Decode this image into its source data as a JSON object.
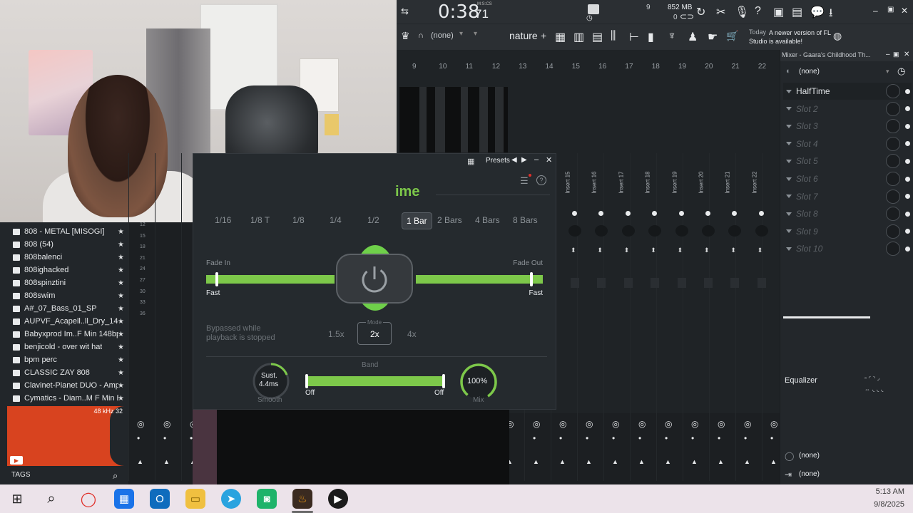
{
  "transport": {
    "time_main": "0:38",
    "time_frac": "71",
    "time_unit": "M:S:CS",
    "cpu_label": "9",
    "memory": "852 MB",
    "memory_sub": "0"
  },
  "toolbar": {
    "preset_none": "(none)",
    "pattern_name": "nature",
    "add_label": "+"
  },
  "notice": {
    "when": "Today",
    "text": "A newer version of FL Studio is available!"
  },
  "playlist": {
    "ruler": [
      "9",
      "10",
      "11",
      "12",
      "13",
      "14",
      "15",
      "16",
      "17",
      "18",
      "19",
      "20",
      "21",
      "22"
    ]
  },
  "mixer_window": {
    "title": "Mixer - Gaara's Childhood Th...",
    "preset": "(none)",
    "slots": [
      {
        "label": "HalfTime",
        "active": true
      },
      {
        "label": "Slot 2"
      },
      {
        "label": "Slot 3"
      },
      {
        "label": "Slot 4"
      },
      {
        "label": "Slot 5"
      },
      {
        "label": "Slot 6"
      },
      {
        "label": "Slot 7"
      },
      {
        "label": "Slot 8"
      },
      {
        "label": "Slot 9"
      },
      {
        "label": "Slot 10"
      }
    ],
    "equalizer_label": "Equalizer",
    "route1": "(none)",
    "route2": "(none)"
  },
  "inserts": [
    "Insert 15",
    "Insert 16",
    "Insert 17",
    "Insert 18",
    "Insert 19",
    "Insert 20",
    "Insert 21",
    "Insert 22"
  ],
  "browser": {
    "items": [
      "808 - METAL [MISOGI]",
      "808 (54)",
      "808balenci",
      "808ighacked",
      "808spinztini",
      "808swim",
      "A#_07_Bass_01_SP",
      "AUPVF_Acapell..ll_Dry_140_Bm",
      "Babyxprod Im..F Min 148bpm]",
      "benjicold - over wit hat",
      "bpm perc",
      "CLASSIC ZAY 808",
      "Clavinet-Pianet DUO - Amp",
      "Cymatics - Diam..M F Min Bass"
    ],
    "sample_rate": "48 kHz 32",
    "tags_label": "TAGS"
  },
  "row_numbers": [
    "12",
    "15",
    "18",
    "21",
    "24",
    "27",
    "30",
    "33",
    "36"
  ],
  "plugin": {
    "presets_label": "Presets",
    "title_fragment": "ime",
    "tabs": [
      "1/16",
      "1/8 T",
      "1/8",
      "1/4",
      "1/2",
      "1 Bar",
      "2 Bars",
      "4 Bars",
      "8 Bars"
    ],
    "active_tab": "1 Bar",
    "fade_in_label": "Fade In",
    "fade_out_label": "Fade Out",
    "fade_in_value": "Fast",
    "fade_out_value": "Fast",
    "bypass_text_1": "Bypassed while",
    "bypass_text_2": "playback is stopped",
    "mode_label": "Mode",
    "modes": [
      "1.5x",
      "2x",
      "4x"
    ],
    "active_mode": "2x",
    "band_label": "Band",
    "band_low": "Off",
    "band_high": "Off",
    "sustain_label": "Sust.",
    "sustain_value": "4.4ms",
    "smooth_label": "Smooth",
    "mix_value": "100%",
    "mix_label": "Mix"
  },
  "taskbar": {
    "time": "5:13 AM",
    "date": "9/8/2025"
  },
  "colors": {
    "accent_green": "#7dc84a",
    "fl_bg": "#1f2326",
    "wave_orange": "#d8431f"
  }
}
